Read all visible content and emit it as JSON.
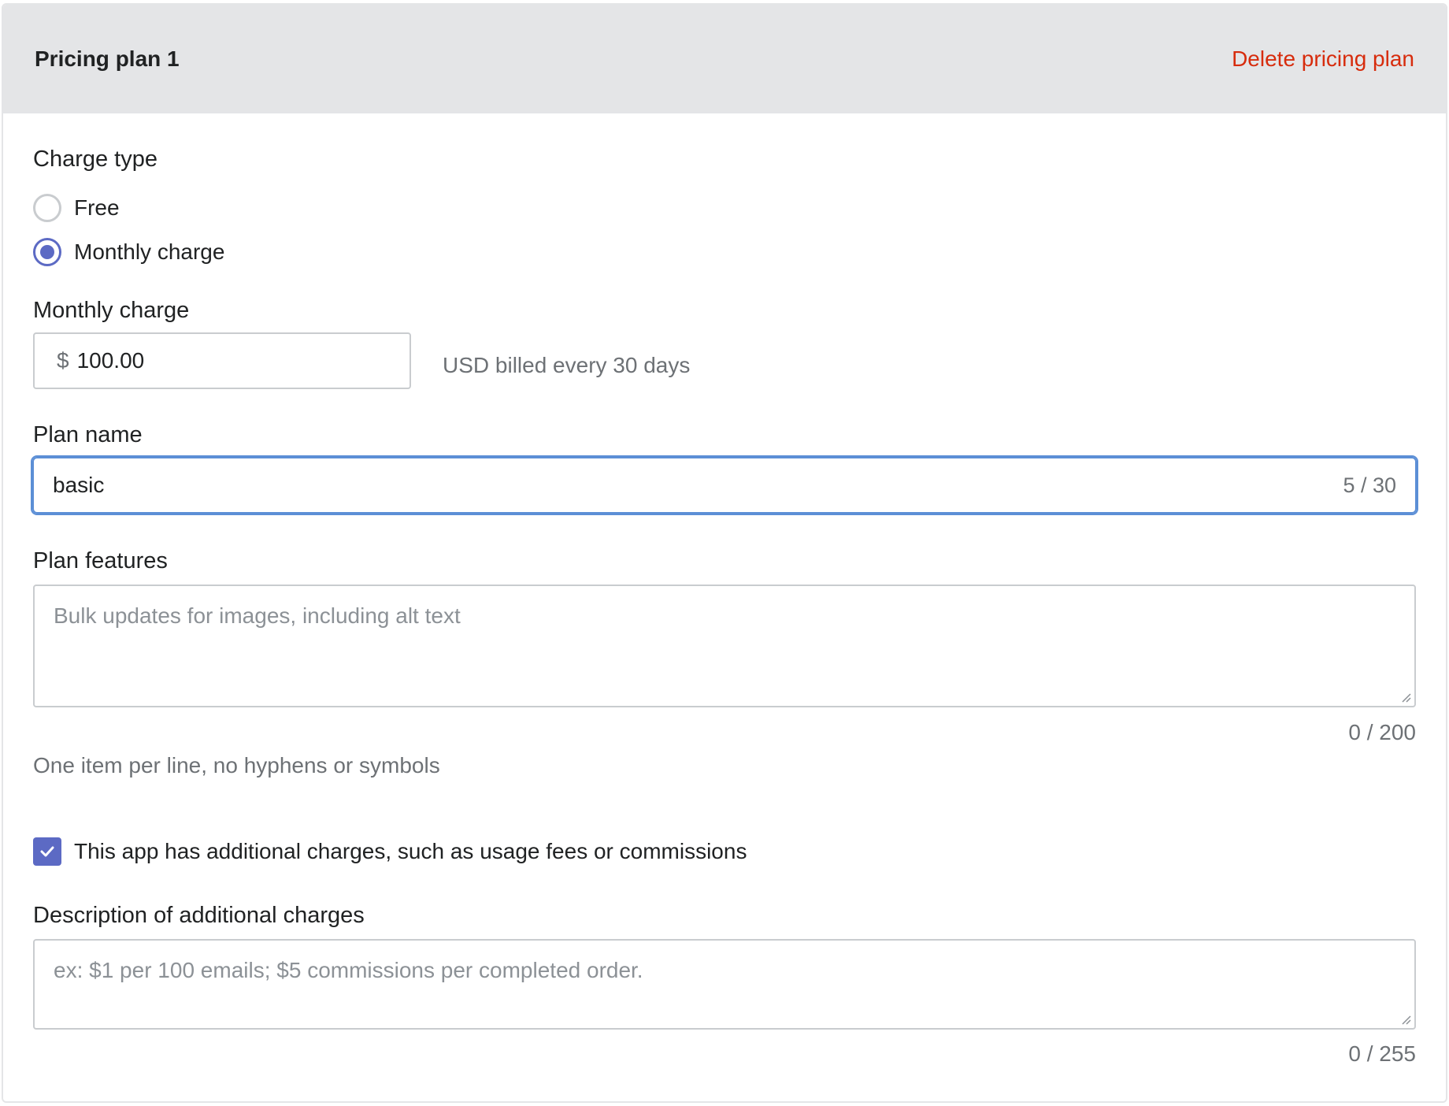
{
  "header": {
    "title": "Pricing plan 1",
    "delete_label": "Delete pricing plan"
  },
  "charge_type": {
    "label": "Charge type",
    "options": [
      {
        "label": "Free",
        "checked": false
      },
      {
        "label": "Monthly charge",
        "checked": true
      }
    ]
  },
  "monthly_charge": {
    "label": "Monthly charge",
    "prefix": "$",
    "value": "100.00",
    "help": "USD billed every 30 days"
  },
  "plan_name": {
    "label": "Plan name",
    "value": "basic",
    "counter": "5 / 30"
  },
  "plan_features": {
    "label": "Plan features",
    "placeholder": "Bulk updates for images, including alt text",
    "counter": "0 / 200",
    "help": "One item per line, no hyphens or symbols"
  },
  "additional_charges": {
    "checkbox_label": "This app has additional charges, such as usage fees or commissions",
    "checked": true,
    "description_label": "Description of additional charges",
    "placeholder": "ex: $1 per 100 emails; $5 commissions per completed order.",
    "counter": "0 / 255"
  },
  "colors": {
    "accent": "#5c6ac4",
    "focus": "#5c8fd6",
    "danger": "#d72c0d",
    "header_bg": "#e4e5e7"
  }
}
